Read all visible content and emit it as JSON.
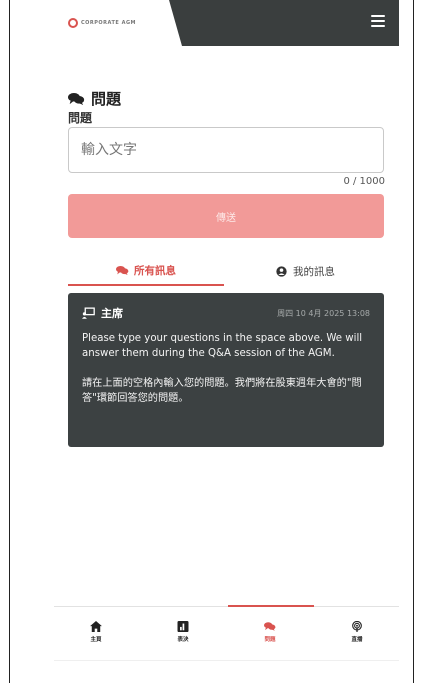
{
  "header": {
    "logo_text": "CORPORATE AGM",
    "menu_icon": "hamburger-menu-icon"
  },
  "page": {
    "title": "問題",
    "title_icon": "chat-bubbles-icon"
  },
  "form": {
    "label": "問題",
    "placeholder": "輸入文字",
    "value": "",
    "counter": "0 / 1000",
    "send_label": "傳送"
  },
  "tabs": {
    "all": "所有訊息",
    "mine": "我的訊息"
  },
  "message": {
    "author": "主席",
    "timestamp": "周四 10 4月 2025 13:08",
    "body_en": "Please type your questions in the space above.  We will answer them during the Q&A session of the AGM.",
    "body_zh": "請在上面的空格內輸入您的問題。我們將在股東週年大會的\"問答\"環節回答您的問題。"
  },
  "nav": {
    "items": [
      {
        "label": "主頁",
        "icon": "home-icon"
      },
      {
        "label": "表決",
        "icon": "vote-icon"
      },
      {
        "label": "問題",
        "icon": "chat-bubbles-icon",
        "active": true
      },
      {
        "label": "直播",
        "icon": "broadcast-icon"
      }
    ]
  },
  "colors": {
    "accent": "#d9534f",
    "send_button": "#f29a98",
    "dark": "#3a3e3e"
  }
}
